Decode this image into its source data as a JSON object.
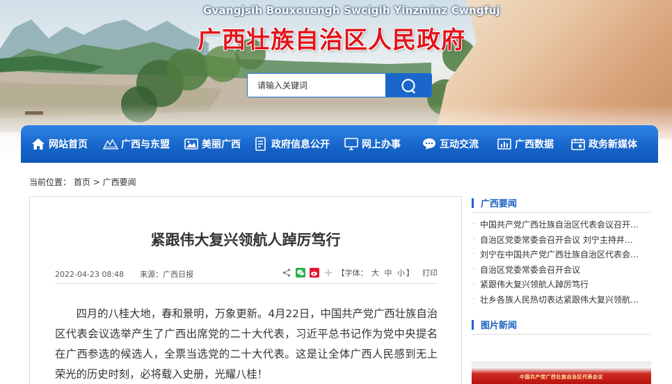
{
  "header": {
    "subtitle": "Gvangjsih Bouxcuengh Swcigih Yinzminz Cwngfuj",
    "title": "广西壮族自治区人民政府"
  },
  "search": {
    "placeholder": "请输入关键词",
    "value": ""
  },
  "nav": {
    "items": [
      {
        "label": "网站首页",
        "icon": "home-icon"
      },
      {
        "label": "广西与东盟",
        "icon": "mountain-icon"
      },
      {
        "label": "美丽广西",
        "icon": "picture-icon"
      },
      {
        "label": "政府信息公开",
        "icon": "document-icon"
      },
      {
        "label": "网上办事",
        "icon": "monitor-icon"
      },
      {
        "label": "互动交流",
        "icon": "chat-icon"
      },
      {
        "label": "广西数据",
        "icon": "chart-icon"
      },
      {
        "label": "政务新媒体",
        "icon": "calendar-icon"
      }
    ]
  },
  "breadcrumb": {
    "prefix": "当前位置：",
    "home": "首页",
    "sep": ">",
    "current": "广西要闻"
  },
  "article": {
    "title": "紧跟伟大复兴领航人踔厉笃行",
    "date": "2022-04-23 08:48",
    "source_label": "来源：",
    "source": "广西日报",
    "font_label": "【字体：",
    "font_big": "大",
    "font_mid": "中",
    "font_small": "小",
    "font_close": "】",
    "print": "打印",
    "body": "四月的八桂大地，春和景明，万象更新。4月22日，中国共产党广西壮族自治区代表会议选举产生了广西出席党的二十大代表，习近平总书记作为党中央提名在广西参选的候选人，全票当选党的二十大代表。这是让全体广西人民感到无上荣光的历史时刻，必将载入史册，光耀八桂！"
  },
  "sidebar": {
    "news_title": "广西要闻",
    "news": [
      "中国共产党广西壮族自治区代表会议召开…",
      "自治区党委常委会召开会议 刘宁主持并…",
      "刘宁在中国共产党广西壮族自治区代表会…",
      "自治区党委常委会召开会议",
      "紧跟伟大复兴领航人踔厉笃行",
      "壮乡各族人民热切表达紧跟伟大复兴领航…"
    ],
    "photo_title": "图片新闻",
    "photo_caption": "中国共产党广西壮族自治区代表会议"
  },
  "colors": {
    "brand_red": "#e3141c",
    "nav_blue": "#1766cb",
    "accent_blue": "#1a63c2"
  }
}
